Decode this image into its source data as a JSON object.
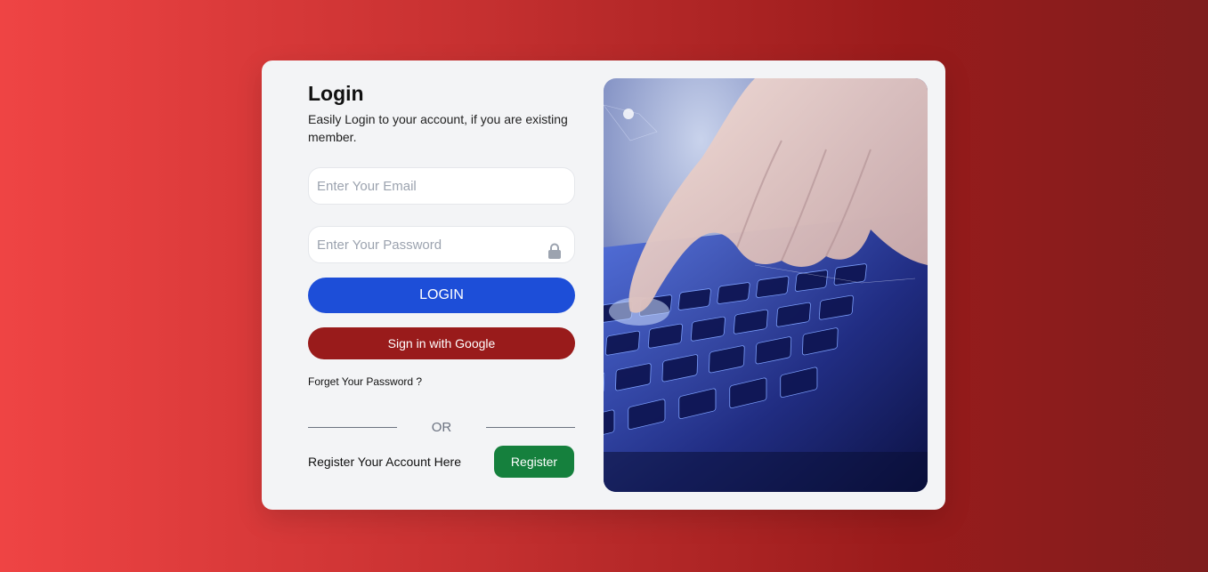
{
  "login": {
    "title": "Login",
    "subtitle": "Easily Login to your account, if you are existing member.",
    "email_placeholder": "Enter Your Email",
    "password_placeholder": "Enter Your Password",
    "login_label": "LOGIN",
    "google_label": "Sign in with Google",
    "forgot_label": "Forget Your Password ?",
    "or_label": "OR",
    "register_text": "Register Your Account Here",
    "register_label": "Register"
  },
  "icons": {
    "password": "lock-icon",
    "hero": "keyboard-hand-image"
  },
  "colors": {
    "login_button": "#1d4ed8",
    "google_button": "#991b1b",
    "register_button": "#15803d",
    "card": "#f3f4f6"
  }
}
